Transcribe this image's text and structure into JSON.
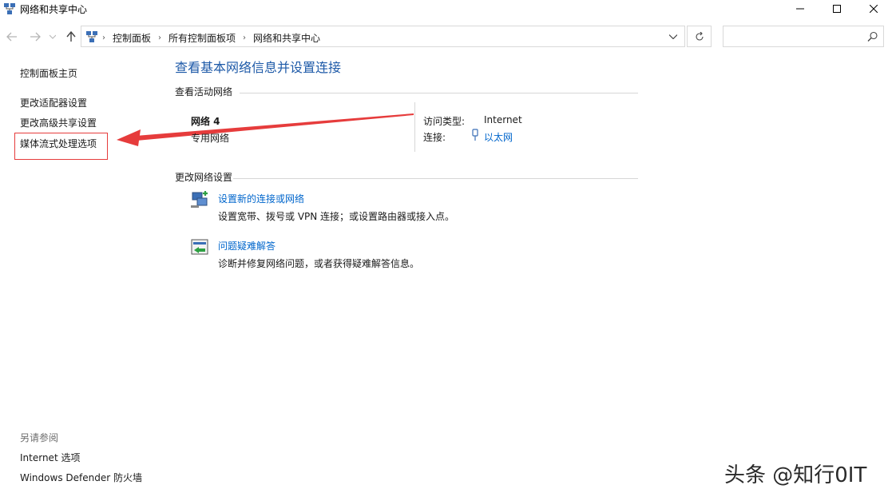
{
  "window": {
    "title": "网络和共享中心"
  },
  "icons": {
    "app": "network-icon",
    "back": "back-arrow-icon",
    "forward": "forward-arrow-icon",
    "recent": "chevron-down-icon",
    "up": "up-arrow-icon",
    "refresh": "refresh-icon",
    "search": "search-icon",
    "ethernet": "ethernet-icon",
    "new_connection": "network-setup-icon",
    "troubleshoot": "troubleshoot-icon"
  },
  "address_bar": {
    "crumbs": [
      "控制面板",
      "所有控制面板项",
      "网络和共享中心"
    ],
    "search_placeholder": ""
  },
  "sidebar": {
    "home": "控制面板主页",
    "items": [
      "更改适配器设置",
      "更改高级共享设置",
      "媒体流式处理选项"
    ],
    "see_also_title": "另请参阅",
    "see_also": [
      "Internet 选项",
      "Windows Defender 防火墙"
    ]
  },
  "main": {
    "heading": "查看基本网络信息并设置连接",
    "active_title": "查看活动网络",
    "network": {
      "name": "网络  4",
      "type": "专用网络",
      "access_label": "访问类型:",
      "access_value": "Internet",
      "conn_label": "连接:",
      "conn_value": "以太网"
    },
    "change_title": "更改网络设置",
    "tasks": [
      {
        "title": "设置新的连接或网络",
        "desc": "设置宽带、拨号或 VPN 连接；或设置路由器或接入点。"
      },
      {
        "title": "问题疑难解答",
        "desc": "诊断并修复网络问题，或者获得疑难解答信息。"
      }
    ]
  },
  "watermark": "头条 @知行0IT",
  "colors": {
    "link": "#0066cc",
    "heading": "#1e5aa8",
    "annotation": "#e63c3c"
  }
}
